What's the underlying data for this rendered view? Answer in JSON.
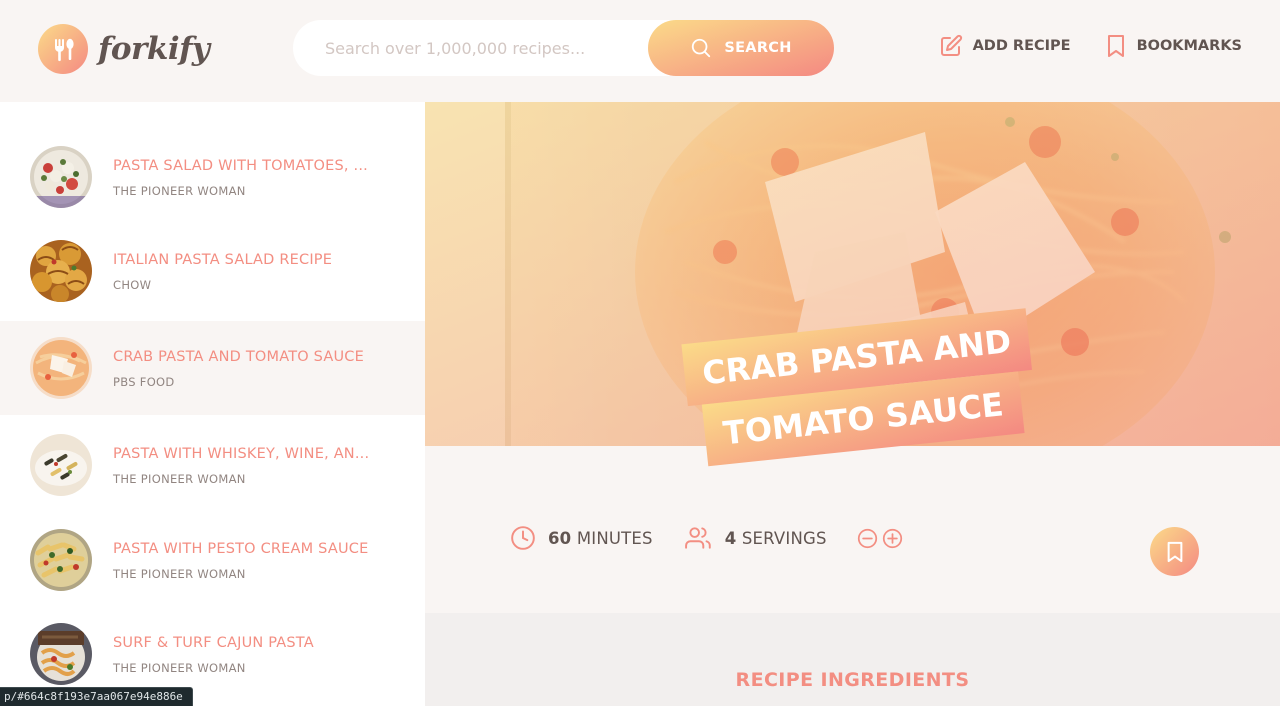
{
  "header": {
    "logo_text": "forkify",
    "search": {
      "placeholder": "Search over 1,000,000 recipes...",
      "value": "",
      "button_label": "SEARCH"
    },
    "nav": {
      "add_recipe": "ADD RECIPE",
      "bookmarks": "BOOKMARKS"
    }
  },
  "results": [
    {
      "title": "PASTA SALAD WITH TOMATOES, ...",
      "publisher": "THE PIONEER WOMAN",
      "active": false
    },
    {
      "title": "ITALIAN PASTA SALAD RECIPE",
      "publisher": "CHOW",
      "active": false
    },
    {
      "title": "CRAB PASTA AND TOMATO SAUCE",
      "publisher": "PBS FOOD",
      "active": true
    },
    {
      "title": "PASTA WITH WHISKEY, WINE, AN...",
      "publisher": "THE PIONEER WOMAN",
      "active": false
    },
    {
      "title": "PASTA WITH PESTO CREAM SAUCE",
      "publisher": "THE PIONEER WOMAN",
      "active": false
    },
    {
      "title": "SURF & TURF CAJUN PASTA",
      "publisher": "THE PIONEER WOMAN",
      "active": false
    }
  ],
  "recipe": {
    "title_line1": "CRAB PASTA AND",
    "title_line2": "TOMATO SAUCE",
    "minutes_value": "60",
    "minutes_label": "MINUTES",
    "servings_value": "4",
    "servings_label": "SERVINGS",
    "ingredients_heading": "RECIPE INGREDIENTS"
  },
  "status_bar": {
    "url": "p/#664c8f193e7aa067e94e886e"
  },
  "colors": {
    "accent": "#f38e82",
    "gradient_start": "#fbdb89",
    "gradient_end": "#f48982",
    "text": "#615551",
    "background": "#f9f5f3"
  },
  "icons": {
    "logo": "fork-spoon-icon",
    "search": "search-icon",
    "add_recipe": "edit-icon",
    "bookmarks": "bookmark-icon",
    "time": "clock-icon",
    "servings": "users-icon",
    "decrease": "minus-circle-icon",
    "increase": "plus-circle-icon"
  }
}
